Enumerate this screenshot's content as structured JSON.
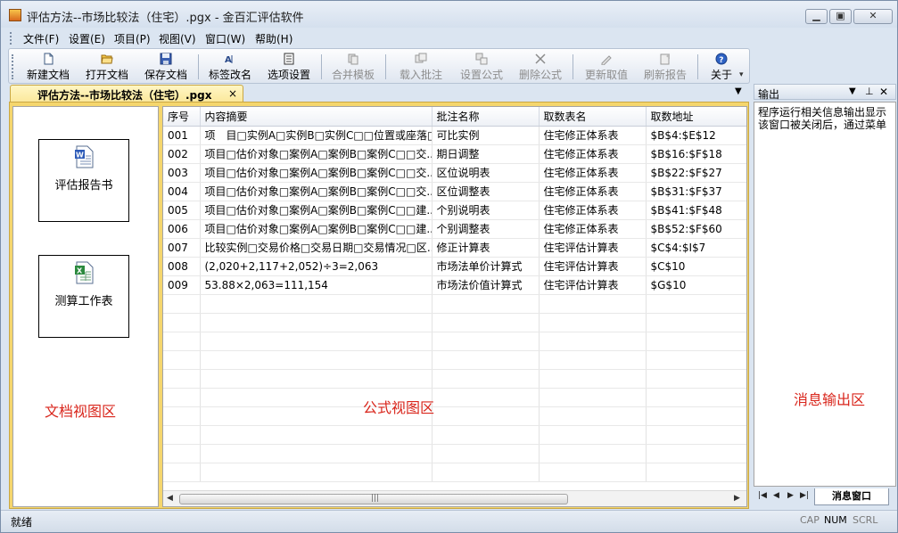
{
  "window": {
    "title": "评估方法--市场比较法（住宅）.pgx - 金百汇评估软件",
    "controls": [
      "minimize",
      "maximize",
      "close"
    ]
  },
  "menu": [
    {
      "label": "文件(F)"
    },
    {
      "label": "设置(E)"
    },
    {
      "label": "项目(P)"
    },
    {
      "label": "视图(V)"
    },
    {
      "label": "窗口(W)"
    },
    {
      "label": "帮助(H)"
    }
  ],
  "toolbar": [
    {
      "label": "新建文档",
      "icon": "new-document-icon",
      "enabled": true
    },
    {
      "label": "打开文档",
      "icon": "open-folder-icon",
      "enabled": true
    },
    {
      "label": "保存文档",
      "icon": "save-disk-icon",
      "enabled": true
    },
    {
      "label": "标签改名",
      "icon": "rename-tag-icon",
      "enabled": true
    },
    {
      "label": "选项设置",
      "icon": "options-icon",
      "enabled": true
    },
    {
      "label": "合并模板",
      "icon": "merge-template-icon",
      "enabled": false
    },
    {
      "label": "载入批注",
      "icon": "load-annotation-icon",
      "enabled": false
    },
    {
      "label": "设置公式",
      "icon": "set-formula-icon",
      "enabled": false
    },
    {
      "label": "删除公式",
      "icon": "delete-formula-icon",
      "enabled": false
    },
    {
      "label": "更新取值",
      "icon": "update-value-icon",
      "enabled": false
    },
    {
      "label": "刷新报告",
      "icon": "refresh-report-icon",
      "enabled": false
    },
    {
      "label": "关于",
      "icon": "about-help-icon",
      "enabled": true
    }
  ],
  "doc_tab": {
    "label": "评估方法--市场比较法（住宅）.pgx",
    "close": "×"
  },
  "doc_view": {
    "items": [
      {
        "label": "评估报告书",
        "icon": "word-document-icon"
      },
      {
        "label": "测算工作表",
        "icon": "excel-sheet-icon"
      }
    ],
    "region_label": "文档视图区"
  },
  "formula_view": {
    "region_label": "公式视图区",
    "columns": [
      "序号",
      "内容摘要",
      "批注名称",
      "取数表名",
      "取数地址"
    ],
    "rows": [
      [
        "001",
        "项　目□实例A□实例B□实例C□□位置或座落□...",
        "可比实例",
        "住宅修正体系表",
        "$B$4:$E$12"
      ],
      [
        "002",
        "项目□估价对象□案例A□案例B□案例C□□交...",
        "期日调整",
        "住宅修正体系表",
        "$B$16:$F$18"
      ],
      [
        "003",
        "项目□估价对象□案例A□案例B□案例C□□交...",
        "区位说明表",
        "住宅修正体系表",
        "$B$22:$F$27"
      ],
      [
        "004",
        "项目□估价对象□案例A□案例B□案例C□□交...",
        "区位调整表",
        "住宅修正体系表",
        "$B$31:$F$37"
      ],
      [
        "005",
        "项目□估价对象□案例A□案例B□案例C□□建...",
        "个别说明表",
        "住宅修正体系表",
        "$B$41:$F$48"
      ],
      [
        "006",
        "项目□估价对象□案例A□案例B□案例C□□建...",
        "个别调整表",
        "住宅修正体系表",
        "$B$52:$F$60"
      ],
      [
        "007",
        "比较实例□交易价格□交易日期□交易情况□区...",
        "修正计算表",
        "住宅评估计算表",
        "$C$4:$I$7"
      ],
      [
        "008",
        "(2,020+2,117+2,052)÷3=2,063",
        "市场法单价计算式",
        "住宅评估计算表",
        "$C$10"
      ],
      [
        "009",
        "53.88×2,063=111,154",
        "市场法价值计算式",
        "住宅评估计算表",
        "$G$10"
      ]
    ],
    "empty_rows": 10
  },
  "output": {
    "title": "输出",
    "lines": [
      "程序运行相关信息输出显示",
      "该窗口被关闭后，通过菜单"
    ],
    "region_label": "消息输出区",
    "tab_label": "消息窗口"
  },
  "status": {
    "text": "就绪",
    "indicators": {
      "cap": "CAP",
      "num": "NUM",
      "scrl": "SCRL"
    }
  }
}
